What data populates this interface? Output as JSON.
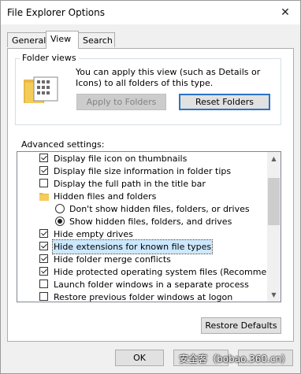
{
  "window": {
    "title": "File Explorer Options",
    "close_glyph": "✕"
  },
  "tabs": [
    {
      "label": "General"
    },
    {
      "label": "View",
      "active": true
    },
    {
      "label": "Search"
    }
  ],
  "folder_views": {
    "group_label": "Folder views",
    "description": "You can apply this view (such as Details or Icons) to all folders of this type.",
    "apply_button": "Apply to Folders",
    "reset_button": "Reset Folders"
  },
  "advanced": {
    "label": "Advanced settings:",
    "items": [
      {
        "type": "checkbox",
        "checked": true,
        "text": "Display file icon on thumbnails"
      },
      {
        "type": "checkbox",
        "checked": true,
        "text": "Display file size information in folder tips"
      },
      {
        "type": "checkbox",
        "checked": false,
        "text": "Display the full path in the title bar"
      },
      {
        "type": "folder",
        "text": "Hidden files and folders"
      },
      {
        "type": "radio",
        "checked": false,
        "text": "Don't show hidden files, folders, or drives"
      },
      {
        "type": "radio",
        "checked": true,
        "text": "Show hidden files, folders, and drives"
      },
      {
        "type": "checkbox",
        "checked": true,
        "text": "Hide empty drives"
      },
      {
        "type": "checkbox",
        "checked": true,
        "text": "Hide extensions for known file types",
        "highlighted": true
      },
      {
        "type": "checkbox",
        "checked": true,
        "text": "Hide folder merge conflicts"
      },
      {
        "type": "checkbox",
        "checked": true,
        "text": "Hide protected operating system files (Recommended)"
      },
      {
        "type": "checkbox",
        "checked": false,
        "text": "Launch folder windows in a separate process"
      },
      {
        "type": "checkbox",
        "checked": false,
        "text": "Restore previous folder windows at logon"
      }
    ],
    "restore_defaults_button": "Restore Defaults"
  },
  "footer": {
    "ok_button": "OK",
    "watermark": "安全客（bobao.360.cn）"
  },
  "colors": {
    "selection": "#cce8ff",
    "default_button_border": "#2b74c7",
    "folder": "#f4cc5a"
  }
}
